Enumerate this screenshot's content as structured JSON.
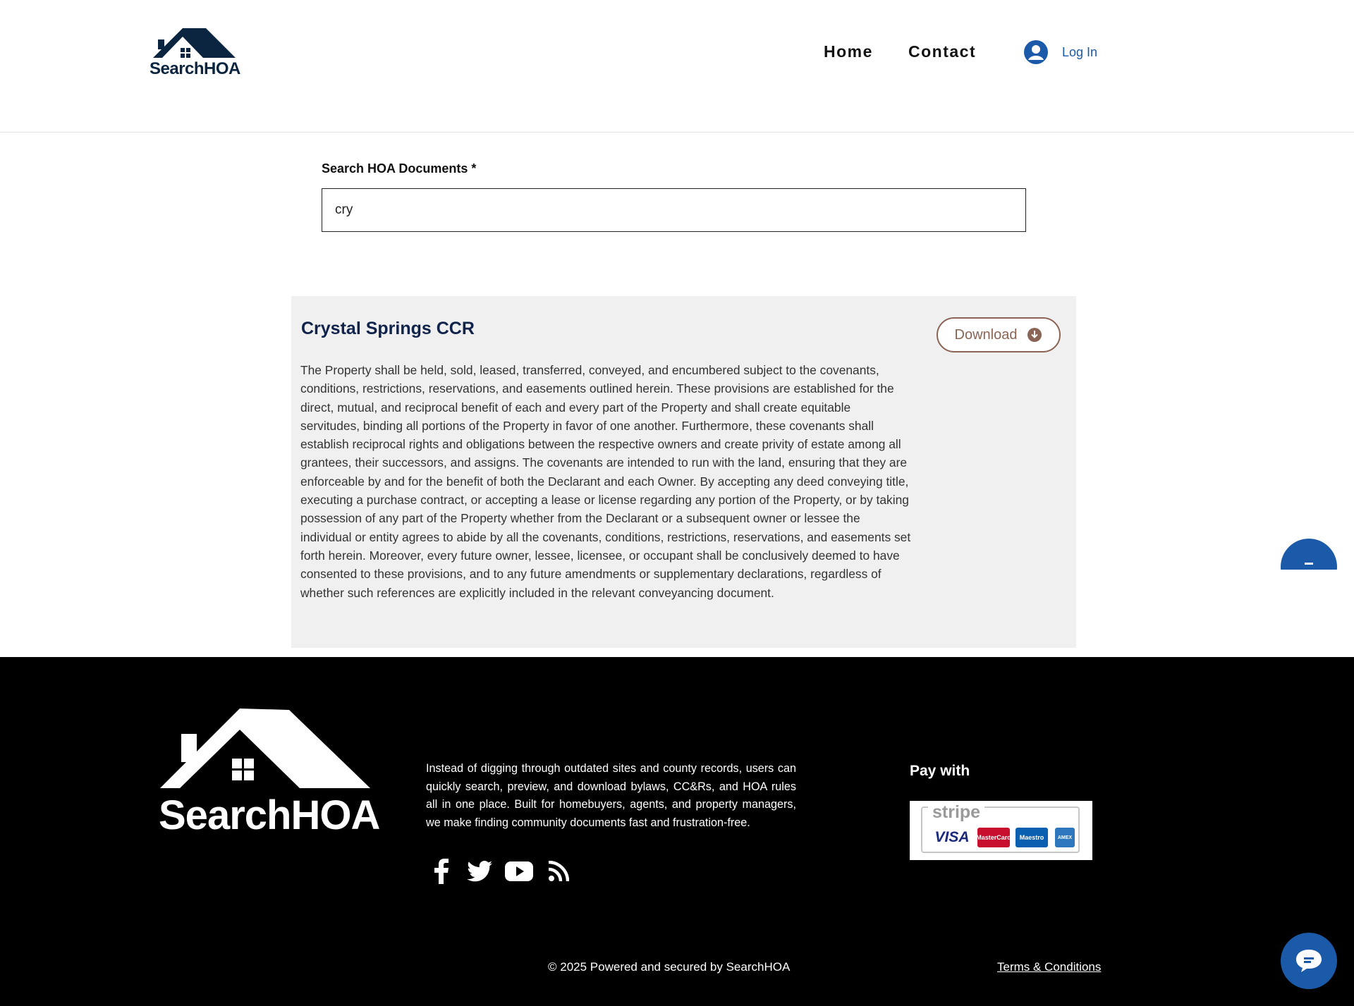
{
  "header": {
    "logo_text": "SearchHOA",
    "nav": [
      {
        "label": "Home"
      },
      {
        "label": "Contact"
      }
    ],
    "login_label": "Log In"
  },
  "search": {
    "label": "Search HOA Documents *",
    "value": "cry"
  },
  "result": {
    "title": "Crystal Springs CCR",
    "download_label": "Download",
    "body": "The Property shall be held, sold, leased, transferred, conveyed, and encumbered subject to the covenants, conditions, restrictions, reservations, and easements outlined herein. These provisions are established for the direct, mutual, and reciprocal benefit of each and every part of the Property and shall create equitable servitudes, binding all portions of the Property in favor of one another. Furthermore, these covenants shall establish reciprocal rights and obligations between the respective owners and create privity of estate among all grantees, their successors, and assigns. The covenants are intended to run with the land, ensuring that they are enforceable by and for the benefit of both the Declarant and each Owner. By accepting any deed conveying title, executing a purchase contract, or accepting a lease or license regarding any portion of the Property, or by taking possession of any part of the Property whether from the Declarant or a subsequent owner or lessee the individual or entity agrees to abide by all the covenants, conditions, restrictions, reservations, and easements set forth herein. Moreover, every future owner, lessee, licensee, or occupant shall be conclusively deemed to have consented to these provisions, and to any future amendments or supplementary declarations, regardless of whether such references are explicitly included in the relevant conveyancing document."
  },
  "footer": {
    "logo_text": "SearchHOA",
    "description": "Instead of digging through outdated sites and county records, users can quickly search, preview, and download bylaws, CC&Rs, and HOA rules all in one place. Built for homebuyers, agents, and property managers, we make finding community documents fast and frustration-free.",
    "social_icons": [
      "facebook-icon",
      "twitter-icon",
      "youtube-icon",
      "rss-icon"
    ],
    "pay_title": "Pay with",
    "pay_brands": {
      "stripe": "stripe",
      "visa": "VISA",
      "mastercard": "MasterCard",
      "maestro": "Maestro",
      "amex": "AMEX"
    },
    "copyright": "© 2025 Powered and secured by SearchHOA",
    "terms_label": "Terms & Conditions"
  },
  "colors": {
    "brand_navy": "#0b2540",
    "link_blue": "#1b5aa8",
    "download_brown": "#8a6455",
    "card_bg": "#f0f0f0",
    "footer_bg": "#000000"
  }
}
